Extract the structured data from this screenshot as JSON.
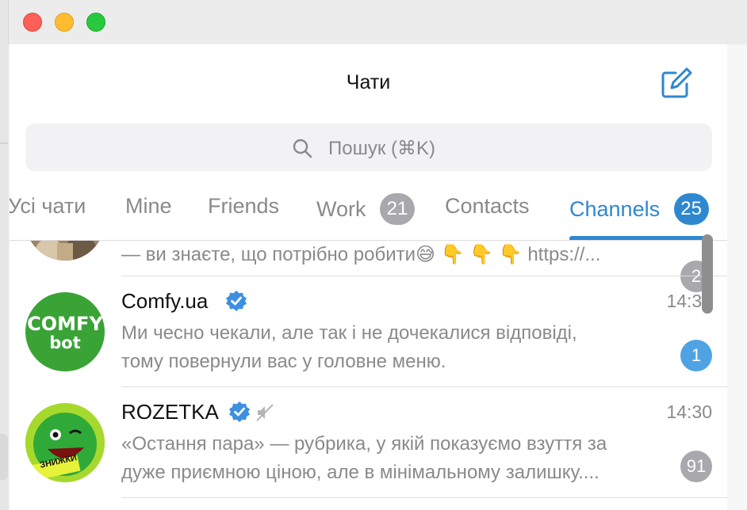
{
  "window": {
    "title": "Чати",
    "compose_icon": "compose-icon"
  },
  "search": {
    "placeholder": "Пошук (⌘K)",
    "icon": "search-icon"
  },
  "tabs": [
    {
      "label": "Усі чати",
      "count": null,
      "active": false
    },
    {
      "label": "Mine",
      "count": null,
      "active": false
    },
    {
      "label": "Friends",
      "count": null,
      "active": false
    },
    {
      "label": "Work",
      "count": "21",
      "active": false
    },
    {
      "label": "Contacts",
      "count": null,
      "active": false
    },
    {
      "label": "Channels",
      "count": "25",
      "active": true
    }
  ],
  "chats": [
    {
      "name": "",
      "preview_line1": "— ви знаєте, що потрібно робити😅 👇 👇 👇   https://...",
      "preview_line2": "",
      "time": "",
      "badge": "2",
      "badge_color": "#a8a8ad"
    },
    {
      "name": "Comfy.ua",
      "verified": true,
      "muted": false,
      "time": "14:34",
      "preview_line1": "Ми чесно чекали, але так і не дочекалися відповіді,",
      "preview_line2": "тому повернули вас у головне меню.",
      "badge": "1",
      "badge_color": "#4fa3e3",
      "avatar_text_1": "COMFY",
      "avatar_text_2": "bot",
      "avatar_color": "#3aa336"
    },
    {
      "name": "ROZETKA",
      "verified": true,
      "muted": true,
      "time": "14:30",
      "preview_line1": "«Остання пара» — рубрика, у якій показуємо взуття за",
      "preview_line2": "дуже приємною ціною, але в мінімальному залишку....",
      "badge": "91",
      "badge_color": "#a8a8ad",
      "avatar_sticker": "ЗНИЖКИ"
    }
  ],
  "colors": {
    "accent": "#2f87d0",
    "verified": "#3d8fe0",
    "badge_gray": "#a8a8ad"
  }
}
